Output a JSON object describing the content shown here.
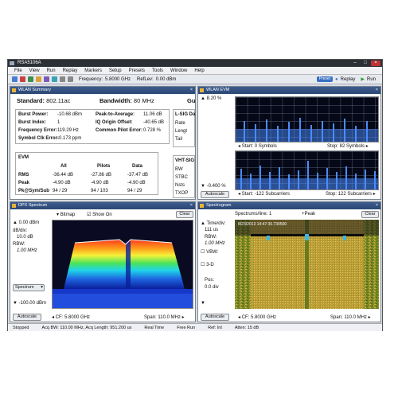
{
  "app": {
    "title": "RSA5106A"
  },
  "menu": [
    "File",
    "View",
    "Run",
    "Replay",
    "Markers",
    "Setup",
    "Presets",
    "Tools",
    "Window",
    "Help"
  ],
  "toolbar": {
    "frequency_label": "Frequency:",
    "frequency": "5.8000 GHz",
    "reflev_label": "RefLev:",
    "reflev": "0.00 dBm",
    "preset": "Preset",
    "replay": "Replay",
    "run": "Run"
  },
  "wlan_summary": {
    "title": "WLAN Summary",
    "standard_label": "Standard:",
    "standard": "802.11ac",
    "bandwidth_label": "Bandwidth:",
    "bandwidth": "80 MHz",
    "cut": "Gu",
    "rows": [
      {
        "l1": "Burst Power:",
        "v1": "-10.68 dBm",
        "l2": "Peak-to-Average:",
        "v2": "11.06 dB"
      },
      {
        "l1": "Burst Index:",
        "v1": "1",
        "l2": "IQ Origin Offset:",
        "v2": "-40.65 dB"
      },
      {
        "l1": "Frequency Error:",
        "v1": "119.29 Hz",
        "l2": "Common Pilot Error:",
        "v2": "0.728 %"
      },
      {
        "l1": "Symbol Clk Error:",
        "v1": "-0.173 ppm",
        "l2": "",
        "v2": ""
      }
    ],
    "lsig": {
      "title": "L-SIG Da",
      "items": [
        "Rate",
        "Lengt",
        "Tail"
      ]
    },
    "evm": {
      "title": "EVM",
      "headers": [
        "All",
        "Pilots",
        "Data"
      ],
      "rows": [
        {
          "label": "RMS",
          "all": "-36.44 dB",
          "pilots": "-27.86 dB",
          "data": "-37.47 dB"
        },
        {
          "label": "Peak",
          "all": "-4.90 dB",
          "pilots": "-4.90 dB",
          "data": "-4.90 dB"
        },
        {
          "label": "Pk@Sym/Sub",
          "all": "94 / 29",
          "pilots": "94 / 103",
          "data": "94 / 29"
        }
      ]
    },
    "vht": {
      "title": "VHT-SIG",
      "items": [
        "BW",
        "STBC",
        "Nsts",
        "TXOP"
      ]
    }
  },
  "wlan_evm": {
    "title": "WLAN EVM",
    "ytop": "8.20 %",
    "ybottom": "-0.400 %",
    "start_symbols": "Start:  0 Symbols",
    "stop_symbols": "Stop:  82 Symbols",
    "start_sub": "Start:  -122 Subcarriers",
    "stop_sub": "Stop:  122 Subcarriers",
    "autoscale": "Autoscale"
  },
  "dpx": {
    "title": "DPX Spectrum",
    "bitmap": "Bitmap",
    "show_label": "Show",
    "on_label": "On",
    "clear": "Clear",
    "ytop": "0.00 dBm",
    "ydiv_label": "dB/div:",
    "ydiv": "10.0 dB",
    "rbw_label": "RBW:",
    "rbw": "1.00 MHz",
    "trace_select": "Spectrum",
    "ybottom": "-100.00 dBm",
    "autoscale": "Autoscale",
    "cf": "CF:  5.8000 GHz",
    "span": "Span:  110.0 MHz"
  },
  "spectrogram": {
    "title": "Spectrogram",
    "spectrums_per_line": "Spectrums/line: 1",
    "peak": "+Peak",
    "clear": "Clear",
    "timediv_label": "Time/div:",
    "timediv": "111 us",
    "rbw_label": "RBW:",
    "rbw": "1.00 MHz",
    "vbw": "VBW:",
    "threed": "3-D",
    "pos_label": "Pos:",
    "pos": "0.0 div",
    "timestamp": "8/23/2013 14:47:30.730500",
    "autoscale": "Autoscale",
    "cf": "CF:  5.8000 GHz",
    "span": "Span:  110.0 MHz"
  },
  "status": [
    "Stopped",
    "Acq BW: 110.00 MHz, Acq Length: 951.200 us",
    "Real Time",
    "Free Run",
    "Ref: Int",
    "Atten: 15 dB"
  ]
}
